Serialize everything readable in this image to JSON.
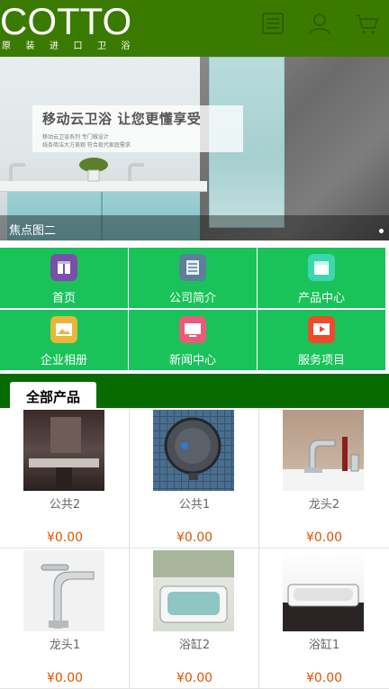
{
  "header": {
    "logo": "COTTO",
    "tagline": "原装进口卫浴",
    "icons": [
      "menu-icon",
      "user-icon",
      "cart-icon"
    ]
  },
  "banner": {
    "headline": "移动云卫浴 让您更懂享受",
    "line1": "移动云卫浴系列 专门做设计",
    "line2": "线条简洁大方美观 符合现代家庭需求",
    "caption": "焦点图二"
  },
  "nav": [
    {
      "label": "首页",
      "icon": "home-icon",
      "color": "#7a4fa8"
    },
    {
      "label": "公司简介",
      "icon": "document-icon",
      "color": "#5e7f99"
    },
    {
      "label": "产品中心",
      "icon": "box-icon",
      "color": "#3dd6b0"
    },
    {
      "label": "企业相册",
      "icon": "photo-icon",
      "color": "#e8b63a"
    },
    {
      "label": "新闻中心",
      "icon": "monitor-icon",
      "color": "#e85c7a"
    },
    {
      "label": "服务项目",
      "icon": "play-icon",
      "color": "#f04a2a"
    }
  ],
  "section": {
    "title": "全部产品"
  },
  "products": [
    {
      "name": "公共2",
      "price": "¥0.00"
    },
    {
      "name": "公共1",
      "price": "¥0.00"
    },
    {
      "name": "龙头2",
      "price": "¥0.00"
    },
    {
      "name": "龙头1",
      "price": "¥0.00"
    },
    {
      "name": "浴缸2",
      "price": "¥0.00"
    },
    {
      "name": "浴缸1",
      "price": "¥0.00"
    }
  ],
  "colors": {
    "header": "#3b7a00",
    "nav": "#19c35a",
    "section": "#076b00",
    "price": "#e15300"
  }
}
